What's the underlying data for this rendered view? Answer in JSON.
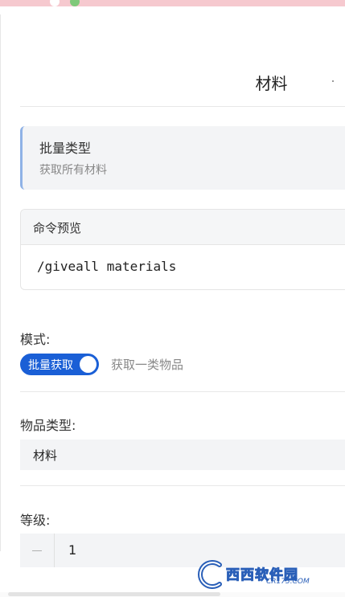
{
  "nav": {
    "title": "材料"
  },
  "info_card": {
    "title": "批量类型",
    "subtitle": "获取所有材料"
  },
  "command_preview": {
    "header": "命令预览",
    "command": "/giveall materials"
  },
  "mode": {
    "label": "模式:",
    "toggle_label": "批量获取",
    "toggle_on": true,
    "description": "获取一类物品"
  },
  "item_type": {
    "label": "物品类型:",
    "value": "材料"
  },
  "level": {
    "label": "等级:",
    "value": "1"
  },
  "watermark": {
    "name": "西西软件园",
    "site": "CR173.COM"
  },
  "colors": {
    "accent": "#1a5fd6",
    "card_border": "#8fb2e6",
    "status_bar": "#f6c9cf"
  }
}
